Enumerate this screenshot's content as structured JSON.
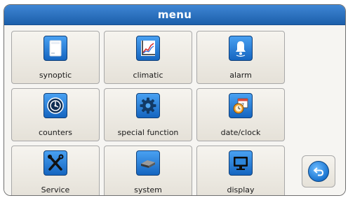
{
  "header": {
    "title": "menu"
  },
  "tiles": [
    {
      "label": "synoptic",
      "icon": "panel-icon"
    },
    {
      "label": "climatic",
      "icon": "chart-icon"
    },
    {
      "label": "alarm",
      "icon": "bell-icon"
    },
    {
      "label": "counters",
      "icon": "meter-icon"
    },
    {
      "label": "special function",
      "icon": "gear-icon"
    },
    {
      "label": "date/clock",
      "icon": "calendar-clock-icon"
    },
    {
      "label": "Service",
      "icon": "tools-icon"
    },
    {
      "label": "system",
      "icon": "hard-disk-icon"
    },
    {
      "label": "display",
      "icon": "monitor-icon"
    }
  ],
  "back_button": {
    "icon": "back-arrow-icon"
  },
  "colors": {
    "title_bar": "#2a73c4",
    "icon_blue": "#1e78d6",
    "tile_bg": "#eeebe4"
  }
}
